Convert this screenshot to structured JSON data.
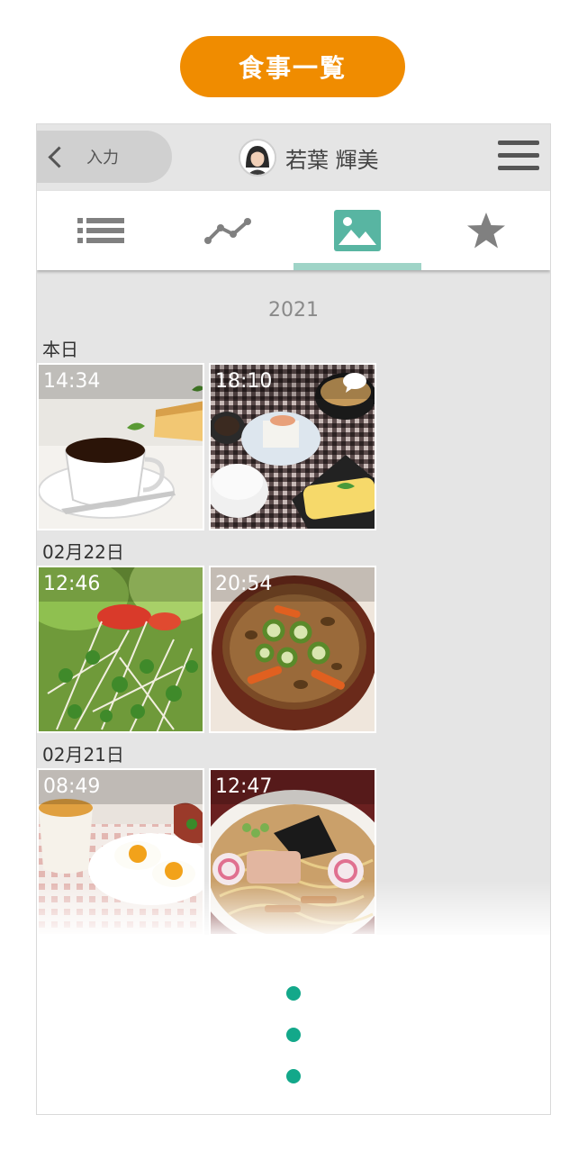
{
  "page_title": "食事一覧",
  "header": {
    "back_label": "入力",
    "user_name": "若葉 輝美"
  },
  "tabs": [
    {
      "icon": "list-icon",
      "active": false
    },
    {
      "icon": "graph-icon",
      "active": false
    },
    {
      "icon": "photo-icon",
      "active": true
    },
    {
      "icon": "star-icon",
      "active": false
    }
  ],
  "colors": {
    "accent": "#f08c00",
    "tab_active": "#58b5a2",
    "tab_inactive": "#808080",
    "dot": "#13a88a"
  },
  "year": "2021",
  "groups": [
    {
      "label": "本日",
      "meals": [
        {
          "time": "14:34",
          "food": "coffee-and-cheesecake",
          "comment": false
        },
        {
          "time": "18:10",
          "food": "japanese-breakfast-set",
          "comment": true
        }
      ]
    },
    {
      "label": "02月22日",
      "meals": [
        {
          "time": "12:46",
          "food": "sprout-salad",
          "comment": false
        },
        {
          "time": "20:54",
          "food": "miso-soup-with-vegetables",
          "comment": false
        }
      ]
    },
    {
      "label": "02月21日",
      "meals": [
        {
          "time": "08:49",
          "food": "fried-eggs-breakfast",
          "comment": false
        },
        {
          "time": "12:47",
          "food": "shoyu-ramen",
          "comment": false
        }
      ]
    }
  ]
}
